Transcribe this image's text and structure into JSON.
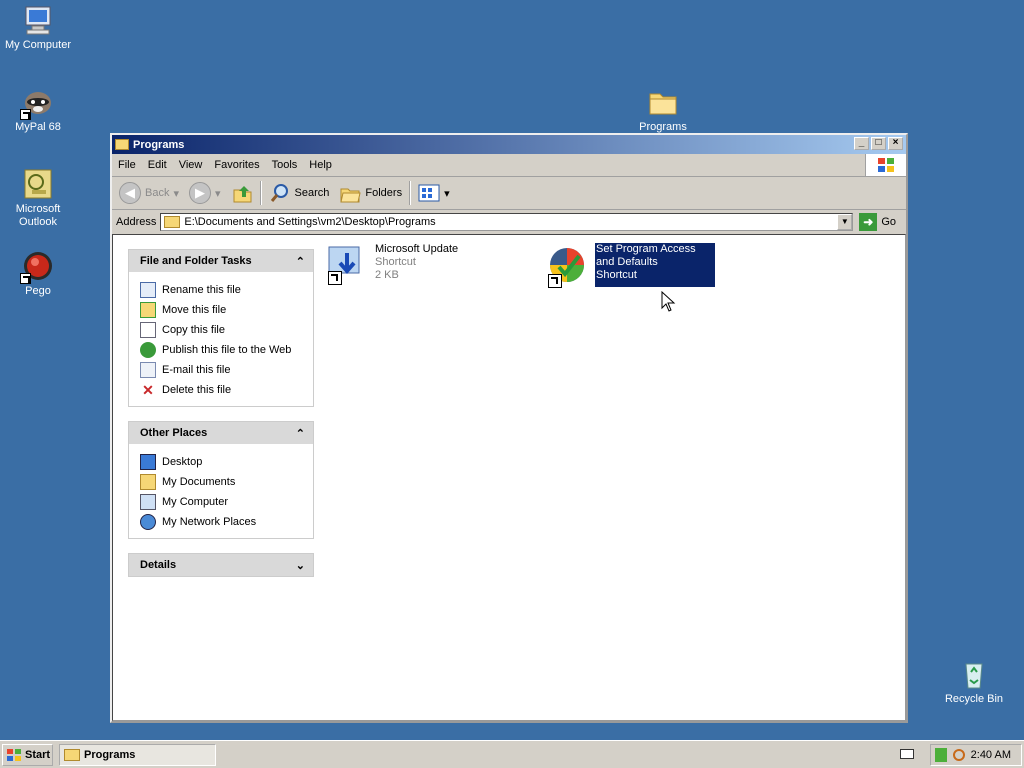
{
  "desktop": {
    "icons": [
      {
        "label": "My Computer"
      },
      {
        "label": "MyPal 68"
      },
      {
        "label": "Microsoft Outlook"
      },
      {
        "label": "Pego"
      },
      {
        "label": "Programs"
      },
      {
        "label": "Recycle Bin"
      }
    ]
  },
  "window": {
    "title": "Programs",
    "menu": [
      "File",
      "Edit",
      "View",
      "Favorites",
      "Tools",
      "Help"
    ],
    "toolbar": {
      "back": "Back",
      "search": "Search",
      "folders": "Folders"
    },
    "address": {
      "label": "Address",
      "value": "E:\\Documents and Settings\\vm2\\Desktop\\Programs",
      "go": "Go"
    },
    "panels": [
      {
        "title": "File and Folder Tasks",
        "items": [
          "Rename this file",
          "Move this file",
          "Copy this file",
          "Publish this file to the Web",
          "E-mail this file",
          "Delete this file"
        ]
      },
      {
        "title": "Other Places",
        "items": [
          "Desktop",
          "My Documents",
          "My Computer",
          "My Network Places"
        ]
      },
      {
        "title": "Details"
      }
    ],
    "files": [
      {
        "name": "Microsoft Update",
        "type": "Shortcut",
        "size": "2 KB"
      },
      {
        "name": "Set Program Access and Defaults",
        "type": "Shortcut"
      }
    ]
  },
  "taskbar": {
    "start": "Start",
    "task": "Programs",
    "clock": "2:40 AM"
  }
}
